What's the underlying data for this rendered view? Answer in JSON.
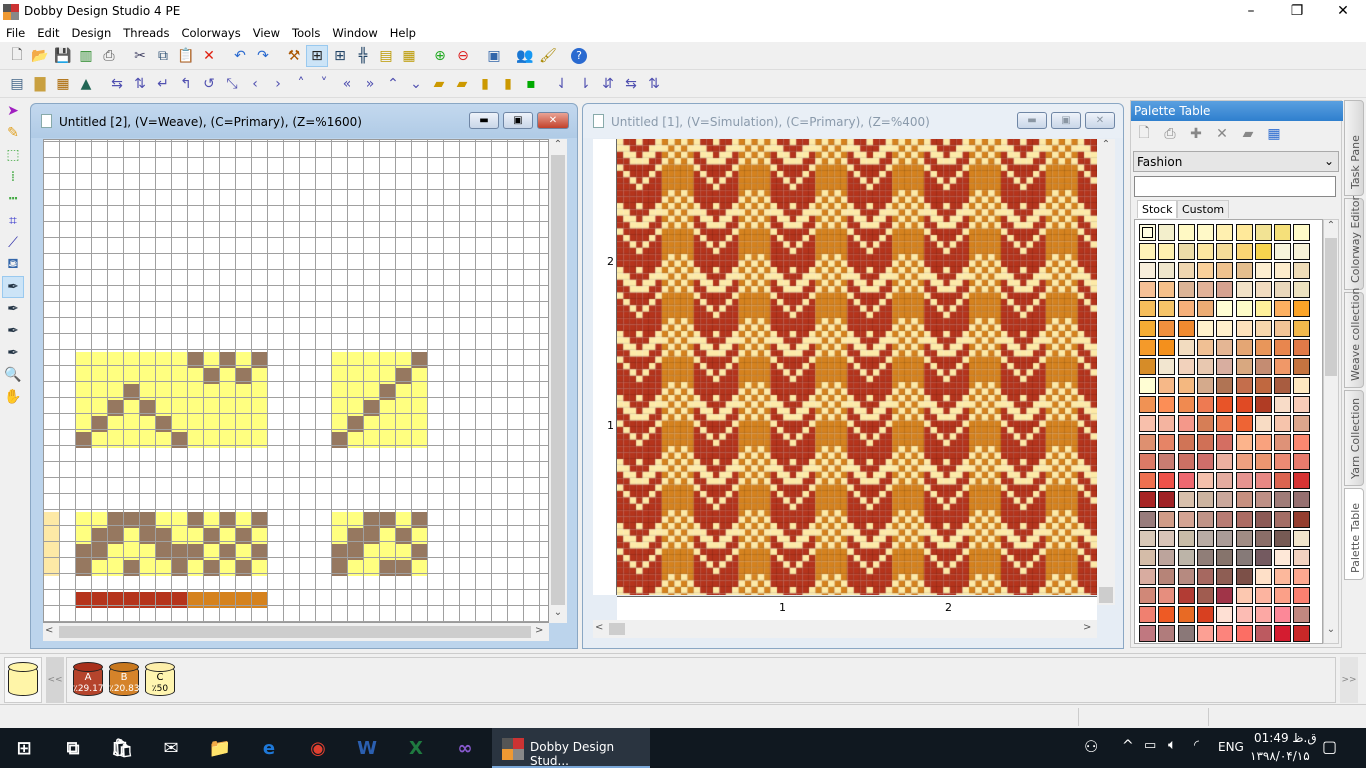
{
  "app": {
    "title": "Dobby Design Studio 4 PE",
    "window_buttons": [
      "–",
      "❐",
      "✕"
    ]
  },
  "menu": [
    "File",
    "Edit",
    "Design",
    "Threads",
    "Colorways",
    "View",
    "Tools",
    "Window",
    "Help"
  ],
  "toolbar1": [
    "new-file",
    "open-folder",
    "save",
    "copy-green",
    "print",
    "|",
    "cut",
    "copy",
    "paste",
    "delete",
    "|",
    "undo",
    "redo",
    "|",
    "tools",
    "weave-view",
    "grid-view",
    "threading-view",
    "tieup-view",
    "simulation-view",
    "|",
    "zoom-in",
    "zoom-out",
    "|",
    "fit-window",
    "|",
    "people",
    "brush",
    "|",
    "help"
  ],
  "toolbar2": [
    "properties",
    "new-sheet",
    "grid-matrix",
    "bottle",
    "|",
    "swap-horizontal",
    "swap-vertical",
    "enter",
    "undo-arrow",
    "rotate-left",
    "flip-diagonal",
    "shift-left",
    "shift-right",
    "shift-up",
    "shift-down",
    "double-left",
    "double-right",
    "double-up",
    "double-down",
    "warp-1",
    "warp-2",
    "weft-1",
    "weft-2",
    "green-grid",
    "|",
    "color-swap-1",
    "color-swap-2",
    "color-swap-3",
    "color-swap-4",
    "color-swap-5"
  ],
  "toolbox": [
    "pointer",
    "pencil",
    "rect-select",
    "column-select",
    "row-select",
    "crop",
    "eyedropper",
    "fill-bucket",
    "pen",
    "pen-add",
    "pen-remove",
    "pen-delete",
    "zoom",
    "hand"
  ],
  "toolbox_selected": "pen",
  "weave_window": {
    "title": "Untitled [2], (V=Weave), (C=Primary), (Z=%1600)",
    "active": true
  },
  "sim_window": {
    "title": "Untitled [1], (V=Simulation), (C=Primary), (Z=%400)",
    "active": false,
    "vruler": [
      "2",
      "1"
    ],
    "hruler": [
      "1",
      "2"
    ]
  },
  "colors": {
    "yellow": "#ffff80",
    "brown": "#967860",
    "red_warp": "#b5341c",
    "orange_warp": "#d5821e",
    "weft": "#fdeaa8",
    "weft_tint": "#fde9a6"
  },
  "weave": {
    "block_a_upper": [
      "000000010101",
      "000000001010",
      "000100000000",
      "001010000000",
      "010001000000",
      "100000100000"
    ],
    "block_a_lower": [
      "001110010101",
      "011011001010",
      "110001110101",
      "100100101010"
    ],
    "block_b_upper": [
      "000001",
      "000010",
      "000100",
      "001000",
      "010000",
      "100000"
    ],
    "block_b_lower": [
      "001101",
      "011010",
      "110001",
      "100110"
    ],
    "warp_colors": [
      "A",
      "A",
      "A",
      "A",
      "A",
      "A",
      "A",
      "B",
      "B",
      "B",
      "B",
      "B"
    ]
  },
  "palette": {
    "title": "Palette Table",
    "tools": [
      "new",
      "print",
      "add",
      "delete",
      "copy",
      "grid"
    ],
    "selected_set": "Fashion",
    "search": "",
    "tabs": [
      "Stock",
      "Custom"
    ],
    "active_tab": "Stock",
    "rows": [
      [
        "#fffde0",
        "#f3efcc",
        "#fff9c4",
        "#fff9c8",
        "#fff0b0",
        "#ffe99a",
        "#f2e394",
        "#f5e07a",
        "#fffbc8"
      ],
      [
        "#fff3b8",
        "#fff1b0",
        "#ecdca8",
        "#fce6a0",
        "#f4dc98",
        "#fad574",
        "#f6d44e",
        "#f6f4dc",
        "#f7f2d8"
      ],
      [
        "#f8eedc",
        "#efe6cc",
        "#efd6b0",
        "#fad09a",
        "#efc28e",
        "#e4be8e",
        "#fdeed0",
        "#fdeccc",
        "#efdcb8"
      ],
      [
        "#f6c096",
        "#f6c08a",
        "#dcb496",
        "#e2b298",
        "#d6a290",
        "#f2e2c8",
        "#f2dcc0",
        "#ead8bc",
        "#ede2c0"
      ],
      [
        "#f6be5c",
        "#f6c468",
        "#f6b07a",
        "#ecac74",
        "#fffed4",
        "#fdfcc8",
        "#fff19a",
        "#fdb060",
        "#fba428"
      ],
      [
        "#f4ac34",
        "#f0903e",
        "#ef8a30",
        "#fff2cc",
        "#fff0cc",
        "#fde2bc",
        "#f6d6ac",
        "#f2c496",
        "#f2b84c"
      ],
      [
        "#f49a2a",
        "#f4901c",
        "#f2dcc0",
        "#f0c094",
        "#e4b694",
        "#e4a674",
        "#e8965a",
        "#e8864e",
        "#e07a48"
      ],
      [
        "#d68c28",
        "#f2e6d0",
        "#f2d2bc",
        "#e8c8b0",
        "#d8aea0",
        "#d8a880",
        "#c48c72",
        "#f09868",
        "#c47440"
      ],
      [
        "#fffed4",
        "#f6b888",
        "#f4b880",
        "#d4aa8c",
        "#b07454",
        "#c46e4c",
        "#c06840",
        "#a85c40",
        "#fee8c0"
      ],
      [
        "#f09254",
        "#fc8e56",
        "#f08a50",
        "#ee7a52",
        "#e85428",
        "#e04a24",
        "#b03c24",
        "#f8dcc8",
        "#f8ccb8"
      ],
      [
        "#f8c0ac",
        "#f4b4a0",
        "#f4988a",
        "#d67e56",
        "#ec7a50",
        "#ee6434",
        "#f8dcc4",
        "#f6c4ac",
        "#dca68c"
      ],
      [
        "#de9070",
        "#e68466",
        "#d07456",
        "#d07056",
        "#d46e62",
        "#fcb48c",
        "#f9a27e",
        "#de9278",
        "#fa8870"
      ],
      [
        "#dc7a66",
        "#c87c72",
        "#cc7064",
        "#ce6e6a",
        "#ecb0a0",
        "#eea080",
        "#ec9670",
        "#ec8a74",
        "#e87a6c"
      ],
      [
        "#ee7050",
        "#ee524a",
        "#ee6870",
        "#f4c0ac",
        "#e4aca0",
        "#e69490",
        "#e88884",
        "#dc6450",
        "#d63434"
      ],
      [
        "#a82424",
        "#a02226",
        "#d8c0ac",
        "#ccb4a0",
        "#caa89c",
        "#c69080",
        "#be9086",
        "#a07c78",
        "#967070"
      ],
      [
        "#987c7c",
        "#d09c88",
        "#d4a494",
        "#c09488",
        "#b87c74",
        "#ac6c64",
        "#8c5a56",
        "#a46e66",
        "#943e30"
      ],
      [
        "#d8c8b8",
        "#d8c4b8",
        "#c8bca8",
        "#b8aca4",
        "#aa9c98",
        "#a08c84",
        "#8a6e68",
        "#765a54",
        "#f2e6cc"
      ],
      [
        "#d4bca8",
        "#bca49c",
        "#bcb4a8",
        "#907e78",
        "#86746c",
        "#867a78",
        "#745a60",
        "#fee8d8",
        "#f2d2c0"
      ],
      [
        "#d8aca0",
        "#b68478",
        "#b68a80",
        "#a66860",
        "#8e5e54",
        "#7c5048",
        "#fee0c8",
        "#fcb89c",
        "#fca890"
      ],
      [
        "#d08878",
        "#e68e7e",
        "#b23c34",
        "#a05c50",
        "#a03448",
        "#fcc8b0",
        "#fcb4a0",
        "#fba088",
        "#fa8070"
      ],
      [
        "#f08070",
        "#ee5a24",
        "#e86a24",
        "#d84020",
        "#fee0d4",
        "#fcbcb4",
        "#fca8a4",
        "#fc8898",
        "#c08880"
      ],
      [
        "#c07880",
        "#b07c7c",
        "#8a7878",
        "#fca094",
        "#fc847c",
        "#fc6e64",
        "#bc5a60",
        "#d41c30",
        "#c82828"
      ]
    ]
  },
  "side_tabs": [
    "Task Pane",
    "Colorway Editor",
    "Weave collection",
    "Yarn Collection",
    "Palette Table"
  ],
  "side_tab_active": "Palette Table",
  "yarns": {
    "current_color": "#fff5a8",
    "scroll_left": "<<",
    "scroll_right": ">>",
    "items": [
      {
        "letter": "A",
        "pct": "٪29.17",
        "color": "#b5442c",
        "top": "#a8301c"
      },
      {
        "letter": "B",
        "pct": "٪20.83",
        "color": "#d5832a",
        "top": "#c8781e"
      },
      {
        "letter": "C",
        "pct": "٪50",
        "color": "#fff5b0",
        "top": "#fdeeaa"
      }
    ]
  },
  "taskbar": {
    "apps": [
      "start",
      "task-view",
      "store",
      "mail",
      "file-explorer",
      "edge",
      "chrome",
      "word",
      "excel",
      "visual-studio"
    ],
    "active_app_label": "Dobby Design Stud...",
    "tray": {
      "lang": "ENG",
      "time": "01:49 ق.ظ",
      "date": "۱۳۹۸/۰۴/۱۵"
    }
  }
}
